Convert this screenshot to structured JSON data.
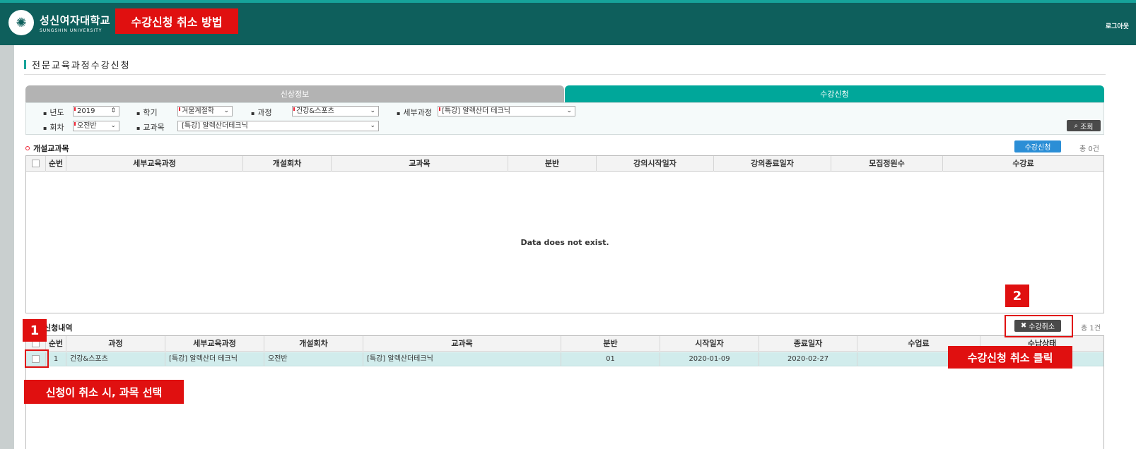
{
  "header": {
    "logo_kr": "성신여자대학교",
    "logo_en": "SUNGSHIN UNIVERSITY",
    "logout": "로그아웃",
    "annotation_title": "수강신청 취소 방법"
  },
  "page": {
    "title": "전문교육과정수강신청"
  },
  "tabs": [
    {
      "label": "신상정보"
    },
    {
      "label": "수강신청"
    }
  ],
  "filters": {
    "year_label": "년도",
    "year_value": "2019",
    "term_label": "학기",
    "term_value": "겨울계절학",
    "course_label": "과정",
    "course_value": "건강&스포츠",
    "detail_label": "세부과정",
    "detail_value": "[특강] 알렉산더 테크닉",
    "round_label": "회차",
    "round_value": "오전반",
    "subject_label": "교과목",
    "subject_value": "[특강] 알렉산더테크닉",
    "search_label": "조회"
  },
  "open_courses": {
    "title": "개설교과목",
    "apply_label": "수강신청",
    "count": "총 0건",
    "columns": [
      "순번",
      "세부교육과정",
      "개설회차",
      "교과목",
      "분반",
      "강의시작일자",
      "강의종료일자",
      "모집정원수",
      "수강료"
    ],
    "empty": "Data does not exist."
  },
  "history": {
    "title": "신청내역",
    "cancel_label": "수강취소",
    "count": "총 1건",
    "columns": [
      "순번",
      "과정",
      "세부교육과정",
      "개설회차",
      "교과목",
      "분반",
      "시작일자",
      "종료일자",
      "수업료",
      "수납상태"
    ],
    "rows": [
      {
        "no": "1",
        "course": "건강&스포츠",
        "detail": "[특강] 알렉산더 테크닉",
        "round": "오전반",
        "subject": "[특강] 알렉산더테크닉",
        "section": "01",
        "start": "2020-01-09",
        "end": "2020-02-27"
      }
    ]
  },
  "annotations": {
    "step1": "1",
    "step2": "2",
    "step1_text": "신청이 취소 시, 과목 선택",
    "step2_text": "수강신청 취소 클릭"
  },
  "colors": {
    "header_bg": "#0e5f5c",
    "accent": "#00a79a",
    "annotation": "#e01010",
    "apply_button": "#2b8ed6"
  }
}
